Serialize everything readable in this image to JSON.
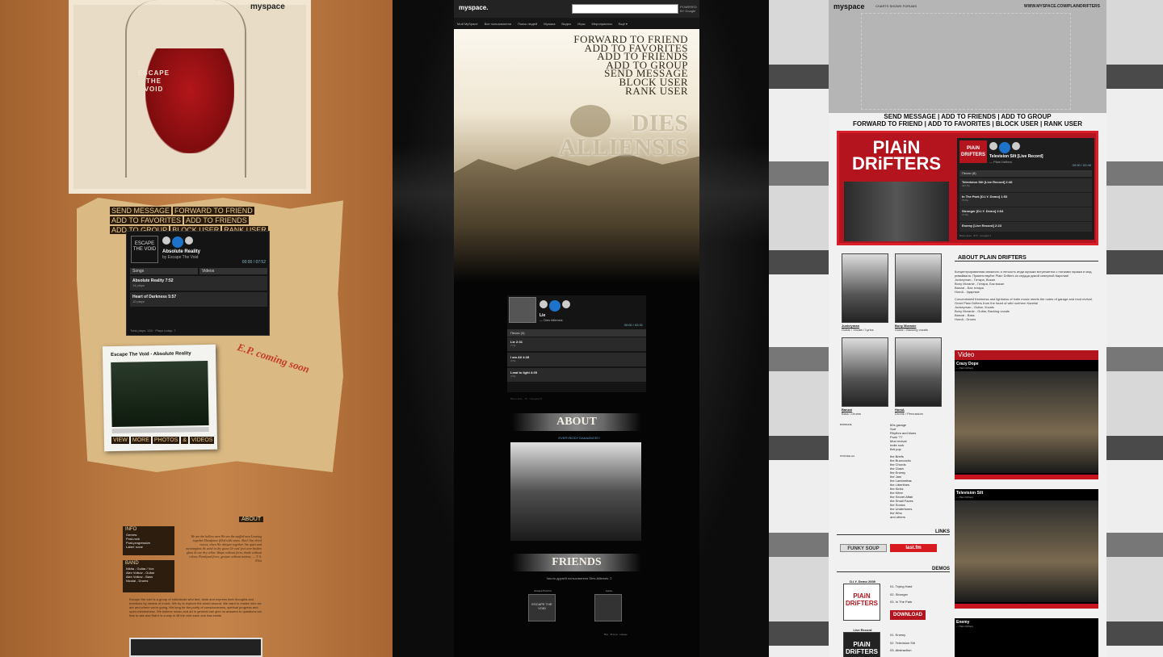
{
  "panel1": {
    "myspace_logo": "myspace",
    "band_name": "ESCAPE THE VOID",
    "links_row1": [
      "SEND MESSAGE",
      "FORWARD TO FRIEND",
      "ADD TO FAVORITES"
    ],
    "links_row2": [
      "ADD TO FRIENDS",
      "ADD TO GROUP",
      "BLOCK USER",
      "RANK USER"
    ],
    "player": {
      "logo_text": "ESCAPE THE VOID",
      "track": "Absolute Reality",
      "artist": "by Escape The Void",
      "time": "00:00 / 07:52",
      "tabs": [
        "Songs",
        "Videos"
      ],
      "songs": [
        {
          "title": "Absolute Reality",
          "duration": "7:52",
          "plays": "14 plays"
        },
        {
          "title": "Heart of Darkness",
          "duration": "5:57",
          "plays": "10 plays"
        }
      ],
      "footer": "Total plays: 134 · Plays today: 7"
    },
    "polaroid_caption": "Escape The Void - Absolute Reality",
    "ep_text": "E.P. coming soon",
    "view_links": [
      "VIEW",
      "MORE",
      "PHOTOS",
      "&",
      "VIDEOS"
    ],
    "info": {
      "header": "INFO",
      "lines": [
        "Genres:",
        "Post-rock",
        "Post-progressive",
        "Label: none"
      ]
    },
    "band": {
      "header": "BAND",
      "lines": [
        "Nikita - Guitar / Vox",
        "Alex Volkov - Guitar",
        "Alex Volkov - Bass",
        "Nicolai - Drums"
      ]
    },
    "about_header": "ABOUT",
    "poem": "We are the hollow men We are the stuffed men Leaning together Headpiece filled with straw. Alas! Our dried voices, when We whisper together Are quiet and meaningless As wind in dry grass Or rats' feet over broken glass In our dry cellar. Shape without form, shade without colour, Paralysed force, gesture without motion; — T. S. Eliot",
    "bio": "Escape the void is a group of individuals who feel, think and express their thoughts and emotions by means of music. We try to explore the world around. We want to realize who we are and where we're going. We long for the purity of consciousness, spiritual progress and open-mindedness. We believe music and art in general can give us answers to questions we fear to ask and that it is a way to fill the void each one has inside."
  },
  "panel2": {
    "myspace_logo": "myspace.",
    "search_placeholder": "",
    "powered_by": "POWERED BY Google",
    "nav": [
      "Мой MySpace",
      "Все пользователи",
      "Поиск людей",
      "Музыка",
      "Видео",
      "Игры",
      "Мероприятия",
      "Ещё ▾"
    ],
    "menu": [
      "FORWARD TO FRIEND",
      "ADD TO FAVORITES",
      "ADD TO FRIENDS",
      "ADD TO GROUP",
      "SEND MESSAGE",
      "BLOCK USER",
      "RANK USER"
    ],
    "title_line1": "DIES",
    "title_line2": "ALLIENSIS",
    "player": {
      "track": "Lie",
      "artist": "— Dies Alliensis",
      "time": "00:00 / 02:31",
      "tab": "Песни",
      "tab_count": "(3)",
      "songs": [
        {
          "title": "Lie",
          "duration": "2:31",
          "plays": "7 Пр."
        },
        {
          "title": "I am All",
          "duration": "4:28",
          "plays": "4 Пр."
        },
        {
          "title": "Lead to light",
          "duration": "4:05",
          "plays": "4 Пр."
        }
      ],
      "footer": "Всего всех · 15 · Сегодня 15"
    },
    "about_banner": "ABOUT",
    "tagline": "EVERYBODY DAAAANCE!!!",
    "friends_banner": "FRIENDS",
    "friend_count": "Число друзей пользователя Dies Alliensis: 2",
    "friends": [
      {
        "name": "EscapeTheVoid",
        "pic_text": "ESCAPE THE VOID"
      },
      {
        "name": "Арсён",
        "pic_text": ""
      }
    ],
    "footer_links": "Все · В сети · Новые"
  },
  "panel3": {
    "myspace_logo": "myspace",
    "header_sub": "CHARTS SHOWS FORUMS",
    "url": "WWW.MYSPACE.COM/PLAINDRIFTERS",
    "actions_line1": "SEND MESSAGE | ADD TO FRIENDS | ADD TO GROUP",
    "actions_line2": "FORWARD TO FRIEND | ADD TO FAVORITES | BLOCK USER | RANK USER",
    "logo_text": "PlAiN DRiFTERS",
    "player": {
      "track": "Television Silt [Live Record]",
      "artist": "— Plain Drifters",
      "time": "00:00 / 02:46",
      "tab": "Песни",
      "tab_count": "(8)",
      "songs": [
        {
          "title": "Television Silt [Live Record]",
          "duration": "2:46",
          "plays": "424 Пр."
        },
        {
          "title": "In The Park [D.I.Y. Demo]",
          "duration": "1:53",
          "plays": "79 Пр."
        },
        {
          "title": "Stronger [D.I.Y. Demo]",
          "duration": "2:04",
          "plays": "71 Пр."
        },
        {
          "title": "Enemy [Live Record]",
          "duration": "2:23",
          "plays": ""
        }
      ],
      "footer": "Всего всех · 8?? · Сегодня 7"
    },
    "members": [
      {
        "name": "Junkeyman",
        "role": "Guitar / Vocals / Lyrics"
      },
      {
        "name": "Bony Moranie",
        "role": "Guitar / Backing vocals"
      },
      {
        "name": "Banzai",
        "role": "Bass / Drums"
      },
      {
        "name": "HomA",
        "role": "Drums / Percussion"
      }
    ],
    "about_header": "ABOUT PLAIN DRIFTERS",
    "about_text_ru": "Концентрированная свежесть и легкость инди музыки встречается с нотками гаража и мод ривайвала. Приветствуйте Plain Drifters из сердца дикой северной Карелии!",
    "members_ru": [
      "Junkeyman - Гитара, Вокал",
      "Bony Moranie - Гитара, Бэк вокал",
      "Banzai - Бас гитара",
      "HomA - Ударные"
    ],
    "about_text_en": "Concentrated freshness and lightness of indie music meets the notes of garage and mod revival. Greet Plain Drifters from the heart of wild northern Karelia!",
    "members_en": [
      "Junkeyman - Guitar, Vocals",
      "Bony Moranie - Guitar, Backing vocals",
      "Banzai - Bass",
      "HomA - Drums"
    ],
    "influences_label": "ВЛИЯНИЕ",
    "influences": [
      "60s garage",
      "Surf",
      "Rhythm and blues",
      "Punk '77",
      "Mod revival",
      "Indie rock",
      "Brit pop"
    ],
    "sounds_label": "ПОХОЖЕ НА",
    "sounds_like": [
      "the Briefs",
      "the Buzzcocks",
      "the Chords",
      "the Clash",
      "the Enemy",
      "the Jam",
      "the Lambrettas",
      "the Libertines",
      "the Kinks",
      "the Kifee",
      "the Secret Affair",
      "the Small Faces",
      "the Sonics",
      "the Undertones",
      "the Who",
      "and others"
    ],
    "video_header": "Video",
    "videos": [
      {
        "title": "Crazy Dope",
        "artist": "— Plain Drifters"
      },
      {
        "title": "Television Silt",
        "artist": "— Plain Drifters"
      },
      {
        "title": "Enemy",
        "artist": "— Plain Drifters"
      }
    ],
    "links_header": "LINKS",
    "link_buttons": [
      "FUNKY SOUP",
      "last.fm"
    ],
    "demos_header": "DEMOS",
    "demo1": {
      "name": "D.I.Y. Demo 2009",
      "cover": "PlAiN DRiFTERS",
      "tracks": [
        "01. Trying Hard",
        "02. Stronger",
        "03. In The Park"
      ]
    },
    "download_label": "DOWNLOAD",
    "demo2": {
      "name": "Live Record",
      "cover": "PlAiN DRiFTERS",
      "tracks": [
        "01. Enemy",
        "02. Television Silt",
        "03. Abstraction"
      ]
    }
  }
}
